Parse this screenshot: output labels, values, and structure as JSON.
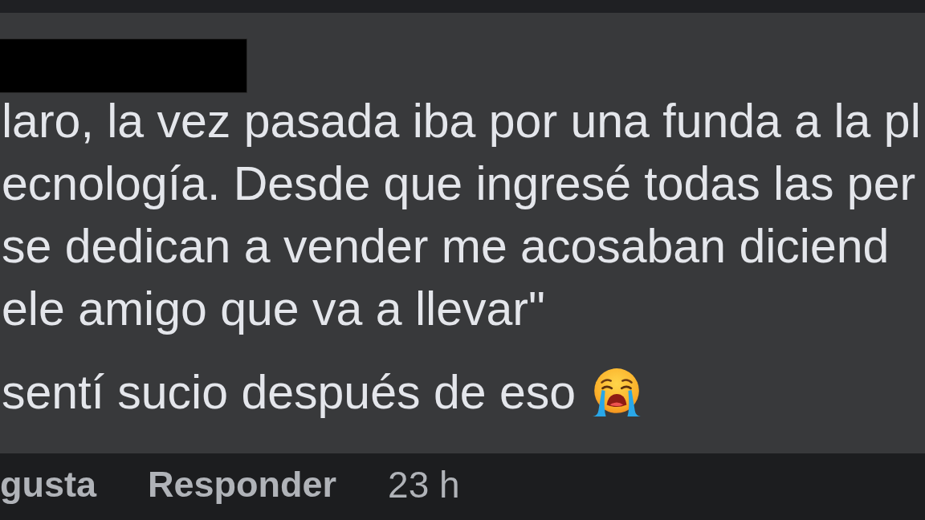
{
  "comment": {
    "author_redacted": true,
    "paragraphs": [
      {
        "lines": [
          "laro, la vez pasada iba por una funda a la pl",
          "ecnología. Desde que ingresé todas las per",
          "se dedican a vender me acosaban diciend",
          "ele amigo que va a llevar\""
        ]
      },
      {
        "lines": [
          "sentí sucio después de eso"
        ],
        "ends_with_emoji": true
      }
    ]
  },
  "actions": [
    {
      "label": "gusta"
    },
    {
      "label": "Responder"
    }
  ],
  "timestamp": "23 h"
}
